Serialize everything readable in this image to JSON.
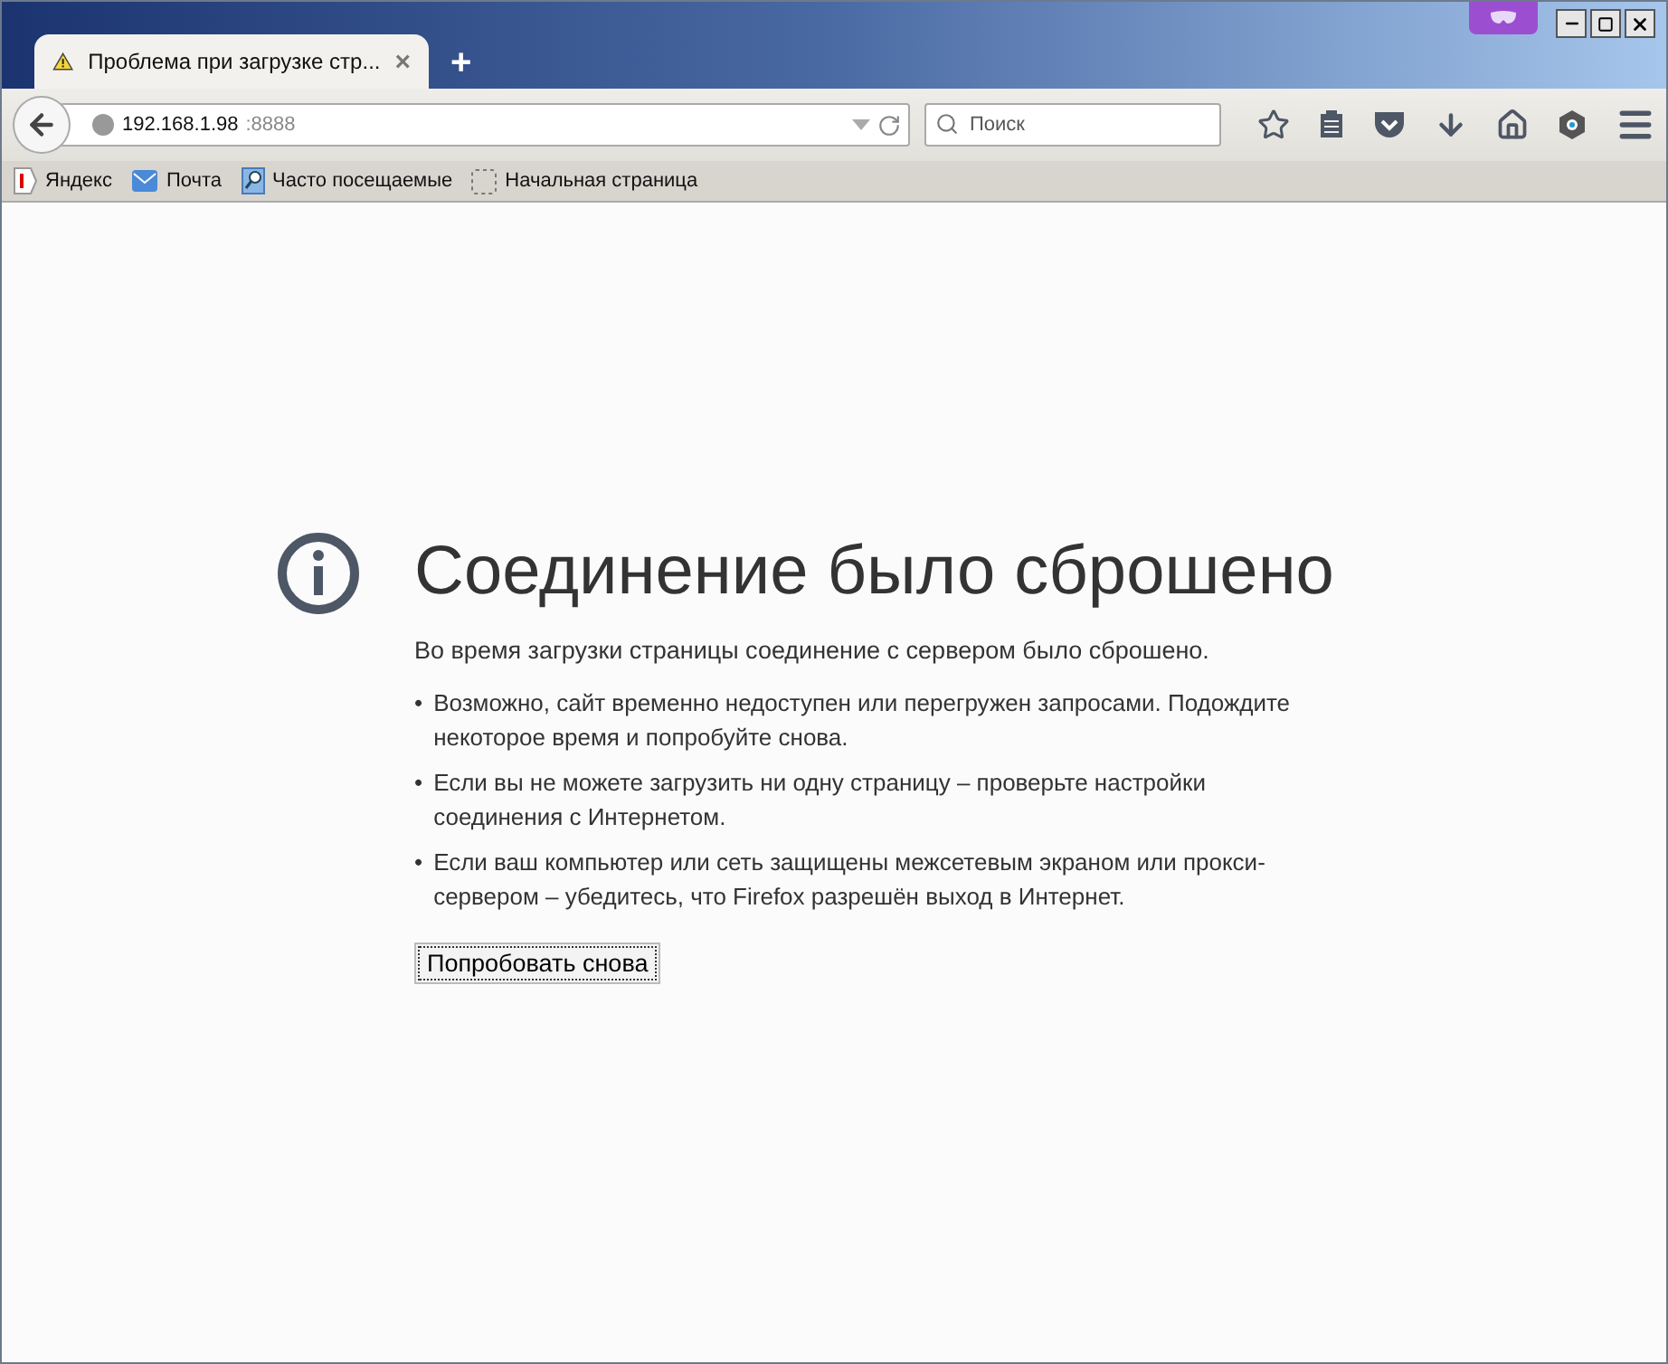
{
  "tab": {
    "title": "Проблема при загрузке стр...",
    "close": "×",
    "new_tab": "+"
  },
  "url": {
    "host": "192.168.1.98",
    "port": ":8888"
  },
  "search": {
    "placeholder": "Поиск"
  },
  "bookmarks": [
    {
      "label": "Яндекс",
      "kind": "yandex"
    },
    {
      "label": "Почта",
      "kind": "mail"
    },
    {
      "label": "Часто посещаемые",
      "kind": "frequent"
    },
    {
      "label": "Начальная страница",
      "kind": "blank"
    }
  ],
  "error": {
    "title": "Соединение было сброшено",
    "intro": "Во время загрузки страницы соединение с сервером было сброшено.",
    "bullet": "•",
    "items": [
      "Возможно, сайт временно недоступен или перегружен запросами. Подождите некоторое время и попробуйте снова.",
      "Если вы не можете загрузить ни одну страницу – проверьте настройки соединения с Интернетом.",
      "Если ваш компьютер или сеть защищены межсетевым экраном или прокси-сервером – убедитесь, что Firefox разрешён выход в Интернет."
    ],
    "button": "Попробовать снова"
  }
}
